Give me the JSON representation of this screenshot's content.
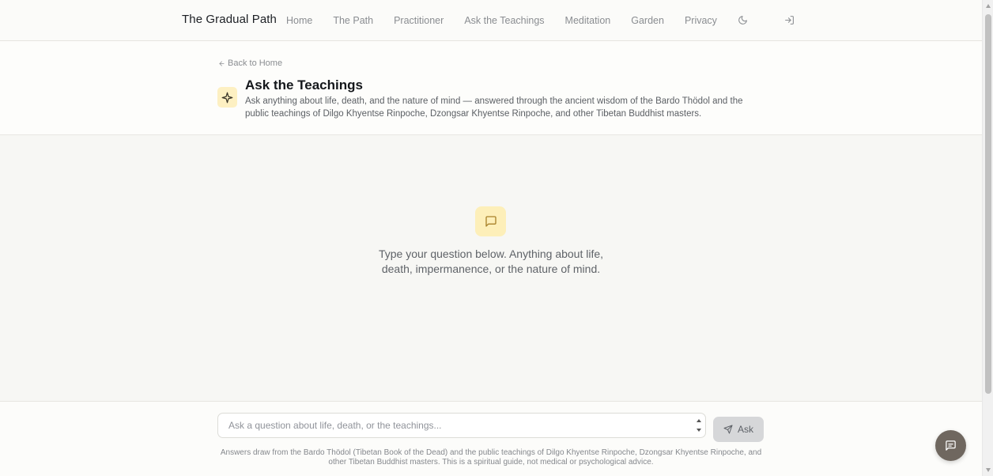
{
  "brand": "The Gradual Path",
  "nav": {
    "items": [
      {
        "label": "Home"
      },
      {
        "label": "The Path"
      },
      {
        "label": "Practitioner"
      },
      {
        "label": "Ask the Teachings"
      },
      {
        "label": "Meditation"
      },
      {
        "label": "Garden"
      },
      {
        "label": "Privacy"
      }
    ],
    "theme_icon": "moon-icon",
    "login_icon": "log-in-icon"
  },
  "header": {
    "back_label": "Back to Home",
    "title": "Ask the Teachings",
    "icon": "sparkle-icon",
    "description": "Ask anything about life, death, and the nature of mind — answered through the ancient wisdom of the Bardo Thödol and the public teachings of Dilgo Khyentse Rinpoche, Dzongsar Khyentse Rinpoche, and other Tibetan Buddhist masters."
  },
  "empty_state": {
    "icon": "message-square-icon",
    "text": "Type your question below. Anything about life, death, impermanence, or the nature of mind."
  },
  "composer": {
    "placeholder": "Ask a question about life, death, or the teachings...",
    "value": "",
    "ask_label": "Ask",
    "disclaimer": "Answers draw from the Bardo Thödol (Tibetan Book of the Dead) and the public teachings of Dilgo Khyentse Rinpoche, Dzongsar Khyentse Rinpoche, and other Tibetan Buddhist masters. This is a spiritual guide, not medical or psychological advice."
  },
  "colors": {
    "accent_soft": "#fdefb9",
    "fab": "#6f675f",
    "background": "#f7f7f4"
  }
}
